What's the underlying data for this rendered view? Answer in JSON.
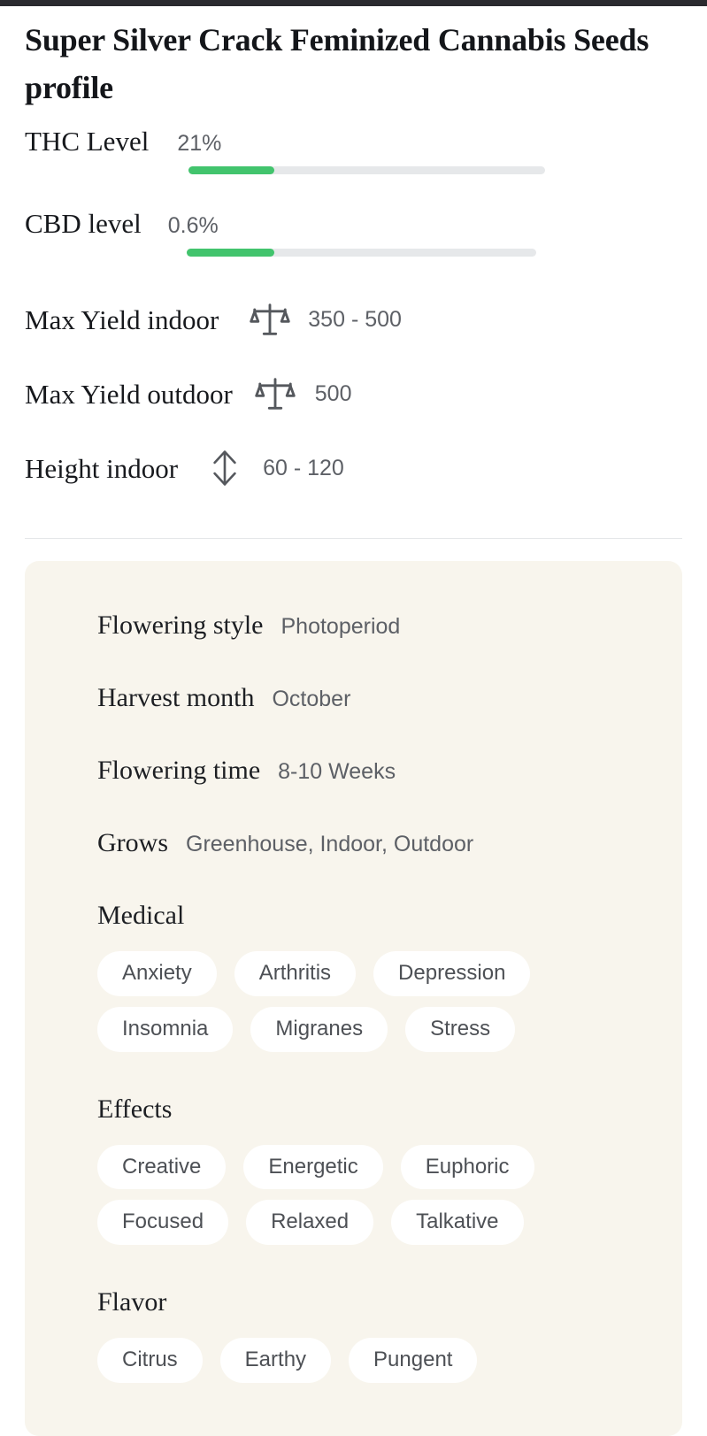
{
  "header": {
    "title": "Super Silver Crack Feminized Cannabis Seeds profile"
  },
  "stats": {
    "thc": {
      "label": "THC Level",
      "value": "21%",
      "fill_percent": 24
    },
    "cbd": {
      "label": "CBD level",
      "value": "0.6%",
      "fill_percent": 25
    },
    "max_yield_indoor": {
      "label": "Max Yield indoor",
      "value": "350 - 500",
      "icon": "scales-icon"
    },
    "max_yield_outdoor": {
      "label": "Max Yield outdoor",
      "value": "500",
      "icon": "scales-icon"
    },
    "height_indoor": {
      "label": "Height indoor",
      "value": "60 - 120",
      "icon": "height-arrow-icon"
    }
  },
  "card": {
    "rows": [
      {
        "label": "Flowering style",
        "value": "Photoperiod"
      },
      {
        "label": "Harvest month",
        "value": "October"
      },
      {
        "label": "Flowering time",
        "value": "8-10 Weeks"
      },
      {
        "label": "Grows",
        "value": "Greenhouse, Indoor, Outdoor"
      }
    ],
    "medical": {
      "title": "Medical",
      "tags": [
        "Anxiety",
        "Arthritis",
        "Depression",
        "Insomnia",
        "Migranes",
        "Stress"
      ]
    },
    "effects": {
      "title": "Effects",
      "tags": [
        "Creative",
        "Energetic",
        "Euphoric",
        "Focused",
        "Relaxed",
        "Talkative"
      ]
    },
    "flavor": {
      "title": "Flavor",
      "tags": [
        "Citrus",
        "Earthy",
        "Pungent"
      ]
    }
  },
  "colors": {
    "accent_green": "#42c46d",
    "track_gray": "#e6e8ea",
    "card_beige": "#f8f5ed",
    "chip_white": "#ffffff",
    "top_strip": "#2b2b2f"
  }
}
